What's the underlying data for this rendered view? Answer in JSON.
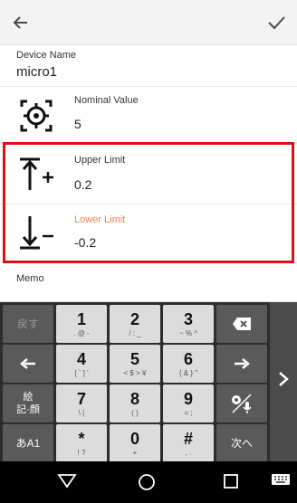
{
  "appbar": {
    "back_icon": "arrow-left-icon",
    "confirm_icon": "check-icon"
  },
  "device_name": {
    "label": "Device Name",
    "value": "micro1"
  },
  "nominal": {
    "label": "Nominal Value",
    "value": "5",
    "icon": "target-focus-icon"
  },
  "upper": {
    "label": "Upper Limit",
    "value": "0.2",
    "icon": "upper-limit-icon"
  },
  "lower": {
    "label": "Lower Limit",
    "value": "-0.2",
    "icon": "lower-limit-icon",
    "label_color": "#f08050"
  },
  "memo": {
    "label": "Memo"
  },
  "highlight_color": "#e01010",
  "keyboard": {
    "back_label": "戻す",
    "k1": {
      "main": "1",
      "sub": ". @ -"
    },
    "k2": {
      "main": "2",
      "sub": "/ : _"
    },
    "k3": {
      "main": "3",
      "sub": "~ % ^"
    },
    "k4": {
      "main": "4",
      "sub": "[ ` ] '"
    },
    "k5": {
      "main": "5",
      "sub": "< $ > ¥"
    },
    "k6": {
      "main": "6",
      "sub": "{ & } \""
    },
    "k7": {
      "main": "7",
      "sub": "\\ |"
    },
    "k8": {
      "main": "8",
      "sub": "( )"
    },
    "k9": {
      "main": "9",
      "sub": "= ;"
    },
    "kstar": {
      "main": "*",
      "sub": "! ?"
    },
    "k0": {
      "main": "0",
      "sub": "+"
    },
    "khash": {
      "main": "#",
      "sub": ", ."
    },
    "emoji_label": "絵\n記·顔",
    "kana_label": "あA1",
    "next_label": "次へ"
  },
  "nav": {
    "back": "triangle-back-icon",
    "home": "circle-home-icon",
    "recent": "square-recent-icon",
    "kbd": "keyboard-icon"
  }
}
